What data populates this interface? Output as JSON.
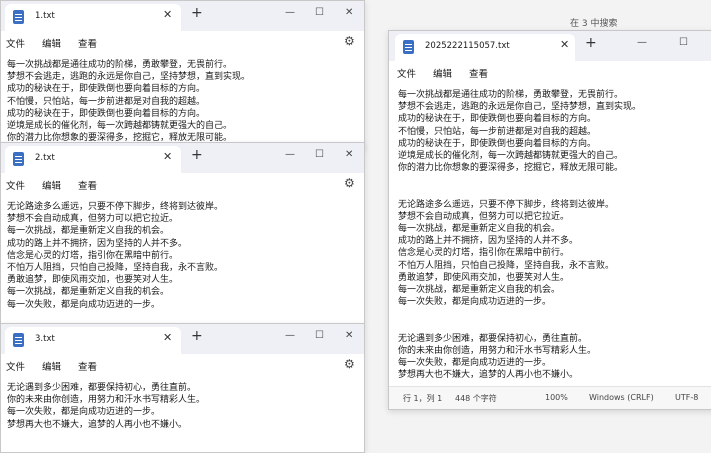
{
  "background_search": "在 3 中搜索",
  "menu": {
    "file": "文件",
    "edit": "编辑",
    "view": "查看"
  },
  "win1": {
    "title": "1.txt",
    "lines": [
      "每一次挑战都是通往成功的阶梯，勇敢攀登，无畏前行。",
      "梦想不会逃走，逃跑的永远是你自己，坚持梦想，直到实现。",
      "成功的秘诀在于，即使跌倒也要向着目标的方向。",
      "不怕慢，只怕站，每一步前进都是对自我的超越。",
      "成功的秘诀在于，即使跌倒也要向着目标的方向。",
      "逆境是成长的催化剂，每一次跨越都铸就更强大的自己。",
      "你的潜力比你想象的要深得多，挖掘它，释放无限可能。"
    ]
  },
  "win2": {
    "title": "2.txt",
    "lines": [
      "无论路途多么遥远，只要不停下脚步，终将到达彼岸。",
      "梦想不会自动成真，但努力可以把它拉近。",
      "每一次挑战，都是重新定义自我的机会。",
      "成功的路上并不拥挤，因为坚持的人并不多。",
      "信念是心灵的灯塔，指引你在黑暗中前行。",
      "不怕万人阻挡，只怕自己投降，坚持自我，永不言败。",
      "勇敢追梦，即使风雨交加，也要笑对人生。",
      "每一次挑战，都是重新定义自我的机会。",
      "每一次失败，都是向成功迈进的一步。"
    ]
  },
  "win3": {
    "title": "3.txt",
    "lines": [
      "无论遇到多少困难，都要保持初心，勇往直前。",
      "你的未来由你创造，用努力和汗水书写精彩人生。",
      "每一次失败，都是向成功迈进的一步。",
      "梦想再大也不嫌大，追梦的人再小也不嫌小。"
    ]
  },
  "win4": {
    "title": "2025222115057.txt",
    "lines": [
      "每一次挑战都是通往成功的阶梯，勇敢攀登，无畏前行。",
      "梦想不会逃走，逃跑的永远是你自己，坚持梦想，直到实现。",
      "成功的秘诀在于，即使跌倒也要向着目标的方向。",
      "不怕慢，只怕站，每一步前进都是对自我的超越。",
      "成功的秘诀在于，即使跌倒也要向着目标的方向。",
      "逆境是成长的催化剂，每一次跨越都铸就更强大的自己。",
      "你的潜力比你想象的要深得多，挖掘它，释放无限可能。",
      "",
      "",
      "无论路途多么遥远，只要不停下脚步，终将到达彼岸。",
      "梦想不会自动成真，但努力可以把它拉近。",
      "每一次挑战，都是重新定义自我的机会。",
      "成功的路上并不拥挤，因为坚持的人并不多。",
      "信念是心灵的灯塔，指引你在黑暗中前行。",
      "不怕万人阻挡，只怕自己投降，坚持自我，永不言败。",
      "勇敢追梦，即使风雨交加，也要笑对人生。",
      "每一次挑战，都是重新定义自我的机会。",
      "每一次失败，都是向成功迈进的一步。",
      "",
      "",
      "无论遇到多少困难，都要保持初心，勇往直前。",
      "你的未来由你创造，用努力和汗水书写精彩人生。",
      "每一次失败，都是向成功迈进的一步。",
      "梦想再大也不嫌大，追梦的人再小也不嫌小。"
    ],
    "status": {
      "position": "行 1，列 1",
      "chars": "448 个字符",
      "zoom": "100%",
      "line_ending": "Windows (CRLF)",
      "encoding": "UTF-8"
    }
  },
  "icons": {
    "close": "✕",
    "add": "+",
    "minimize": "—",
    "maximize": "☐",
    "settings": "⚙"
  }
}
